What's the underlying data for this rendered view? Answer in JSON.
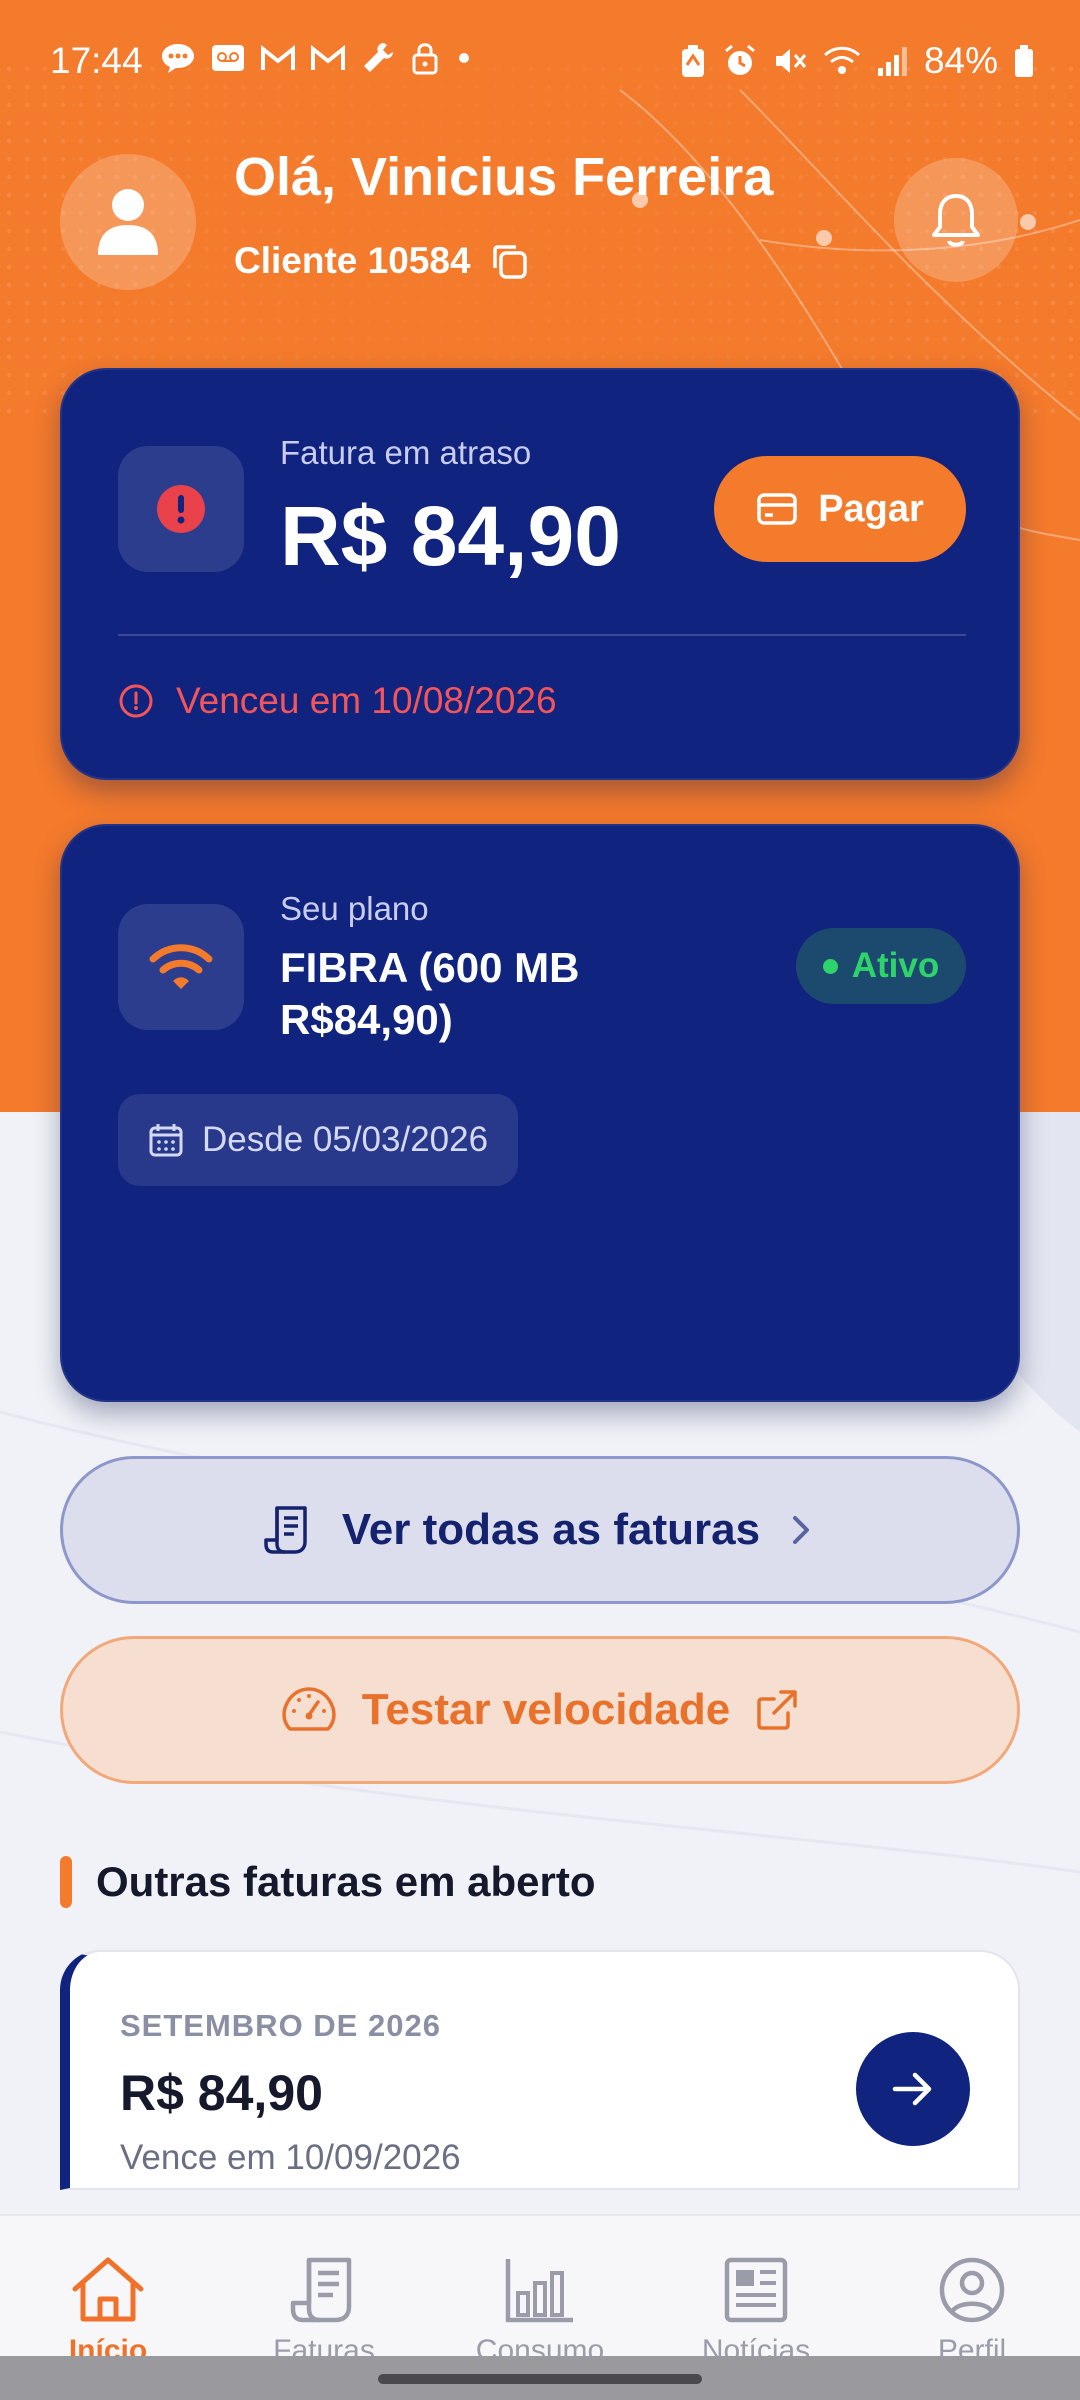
{
  "status_bar": {
    "time": "17:44",
    "battery": "84%"
  },
  "header": {
    "greeting": "Olá, Vinicius Ferreira",
    "client": "Cliente 10584"
  },
  "invoice_card": {
    "label": "Fatura em atraso",
    "amount": "R$ 84,90",
    "pay_label": "Pagar",
    "overdue_text": "Venceu em 10/08/2026"
  },
  "plan_card": {
    "label": "Seu plano",
    "name": "FIBRA (600 MB R$84,90)",
    "status": "Ativo",
    "since": "Desde 05/03/2026"
  },
  "actions": {
    "all_invoices": "Ver todas as faturas",
    "speed_test": "Testar velocidade"
  },
  "open_invoices": {
    "title": "Outras faturas em aberto",
    "items": [
      {
        "month": "SETEMBRO DE 2026",
        "amount": "R$ 84,90",
        "due": "Vence em 10/09/2026"
      }
    ]
  },
  "nav": {
    "items": [
      {
        "label": "Início",
        "icon": "home-icon",
        "active": true
      },
      {
        "label": "Faturas",
        "icon": "receipt-icon",
        "active": false
      },
      {
        "label": "Consumo",
        "icon": "bar-chart-icon",
        "active": false
      },
      {
        "label": "Notícias",
        "icon": "newspaper-icon",
        "active": false
      },
      {
        "label": "Perfil",
        "icon": "profile-icon",
        "active": false
      }
    ]
  },
  "colors": {
    "brand_orange": "#f47a2c",
    "brand_navy": "#10237e",
    "alert_red": "#f3555a",
    "success_green": "#2fd36b"
  }
}
